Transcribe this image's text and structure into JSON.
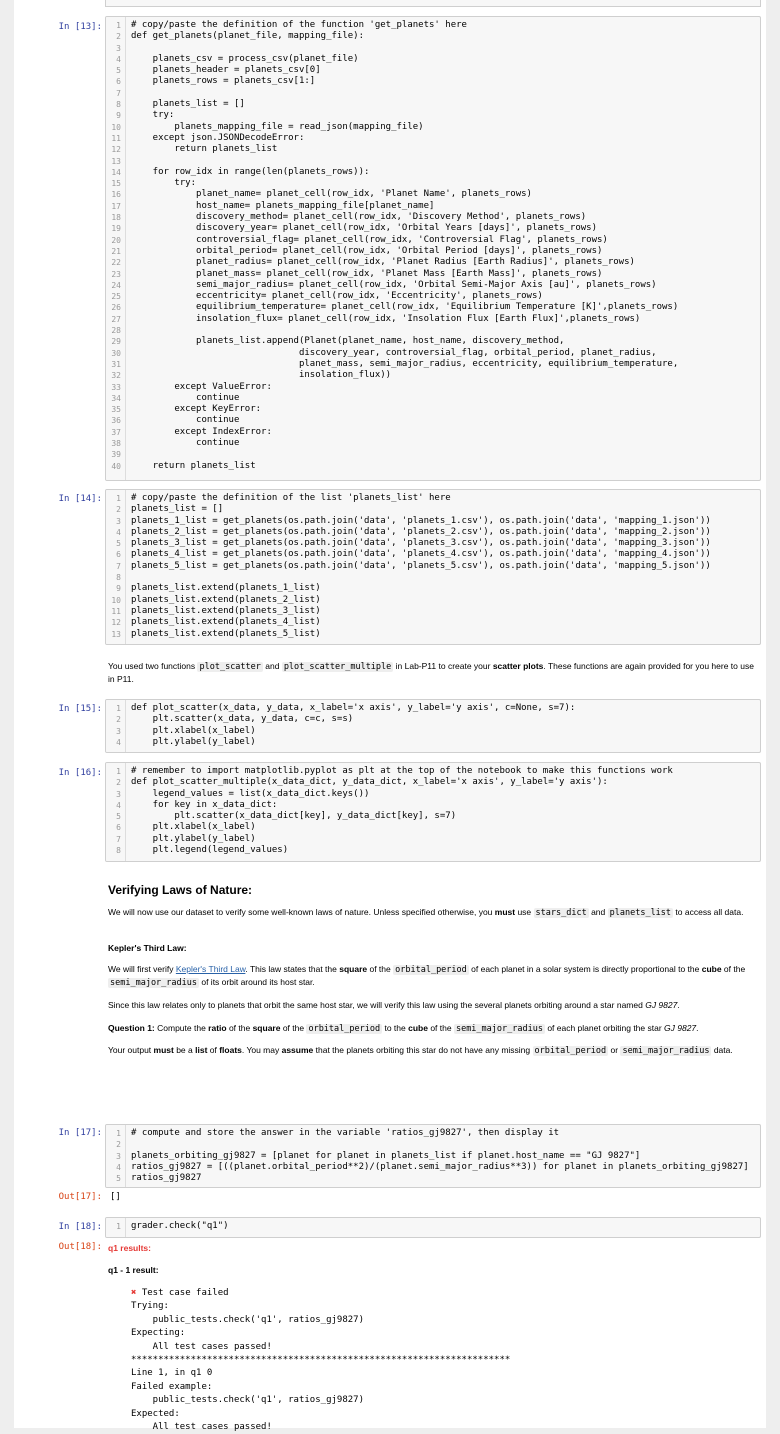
{
  "cells": {
    "c13": {
      "prompt": "In [13]:",
      "lines": [
        "# copy/paste the definition of the function 'get_planets' here",
        "def get_planets(planet_file, mapping_file):",
        "",
        "    planets_csv = process_csv(planet_file)",
        "    planets_header = planets_csv[0]",
        "    planets_rows = planets_csv[1:]",
        "",
        "    planets_list = []",
        "    try:",
        "        planets_mapping_file = read_json(mapping_file)",
        "    except json.JSONDecodeError:",
        "        return planets_list",
        "",
        "    for row_idx in range(len(planets_rows)):",
        "        try:",
        "            planet_name= planet_cell(row_idx, 'Planet Name', planets_rows)",
        "            host_name= planets_mapping_file[planet_name]",
        "            discovery_method= planet_cell(row_idx, 'Discovery Method', planets_rows)",
        "            discovery_year= planet_cell(row_idx, 'Orbital Years [days]', planets_rows)",
        "            controversial_flag= planet_cell(row_idx, 'Controversial Flag', planets_rows)",
        "            orbital_period= planet_cell(row_idx, 'Orbital Period [days]', planets_rows)",
        "            planet_radius= planet_cell(row_idx, 'Planet Radius [Earth Radius]', planets_rows)",
        "            planet_mass= planet_cell(row_idx, 'Planet Mass [Earth Mass]', planets_rows)",
        "            semi_major_radius= planet_cell(row_idx, 'Orbital Semi-Major Axis [au]', planets_rows)",
        "            eccentricity= planet_cell(row_idx, 'Eccentricity', planets_rows)",
        "            equilibrium_temperature= planet_cell(row_idx, 'Equilibrium Temperature [K]',planets_rows)",
        "            insolation_flux= planet_cell(row_idx, 'Insolation Flux [Earth Flux]',planets_rows)",
        "",
        "            planets_list.append(Planet(planet_name, host_name, discovery_method,",
        "                               discovery_year, controversial_flag, orbital_period, planet_radius,",
        "                               planet_mass, semi_major_radius, eccentricity, equilibrium_temperature,",
        "                               insolation_flux))",
        "        except ValueError:",
        "            continue",
        "        except KeyError:",
        "            continue",
        "        except IndexError:",
        "            continue",
        "",
        "    return planets_list"
      ]
    },
    "c14": {
      "prompt": "In [14]:",
      "lines": [
        "# copy/paste the definition of the list 'planets_list' here",
        "planets_list = []",
        "planets_1_list = get_planets(os.path.join('data', 'planets_1.csv'), os.path.join('data', 'mapping_1.json'))",
        "planets_2_list = get_planets(os.path.join('data', 'planets_2.csv'), os.path.join('data', 'mapping_2.json'))",
        "planets_3_list = get_planets(os.path.join('data', 'planets_3.csv'), os.path.join('data', 'mapping_3.json'))",
        "planets_4_list = get_planets(os.path.join('data', 'planets_4.csv'), os.path.join('data', 'mapping_4.json'))",
        "planets_5_list = get_planets(os.path.join('data', 'planets_5.csv'), os.path.join('data', 'mapping_5.json'))",
        "",
        "planets_list.extend(planets_1_list)",
        "planets_list.extend(planets_2_list)",
        "planets_list.extend(planets_3_list)",
        "planets_list.extend(planets_4_list)",
        "planets_list.extend(planets_5_list)"
      ]
    },
    "md1": {
      "t1": "You used two functions ",
      "c1": "plot_scatter",
      "t2": " and ",
      "c2": "plot_scatter_multiple",
      "t3": " in Lab-P11 to create your ",
      "b1": "scatter plots",
      "t4": ". These functions are again provided for you here to use in P11."
    },
    "c15": {
      "prompt": "In [15]:",
      "lines": [
        "def plot_scatter(x_data, y_data, x_label='x axis', y_label='y axis', c=None, s=7):",
        "    plt.scatter(x_data, y_data, c=c, s=s)",
        "    plt.xlabel(x_label)",
        "    plt.ylabel(y_label)"
      ]
    },
    "c16": {
      "prompt": "In [16]:",
      "lines": [
        "# remember to import matplotlib.pyplot as plt at the top of the notebook to make this functions work",
        "def plot_scatter_multiple(x_data_dict, y_data_dict, x_label='x axis', y_label='y axis'):",
        "    legend_values = list(x_data_dict.keys())",
        "    for key in x_data_dict:",
        "        plt.scatter(x_data_dict[key], y_data_dict[key], s=7)",
        "    plt.xlabel(x_label)",
        "    plt.ylabel(y_label)",
        "    plt.legend(legend_values)"
      ]
    },
    "md2": {
      "heading": "Verifying Laws of Nature:",
      "p1a": "We will now use our dataset to verify some well-known laws of nature. Unless specified otherwise, you ",
      "p1b": "must",
      "p1c": " use ",
      "p1d": "stars_dict",
      "p1e": " and ",
      "p1f": "planets_list",
      "p1g": " to access all data.",
      "h3": "Kepler's Third Law:",
      "p2a": "We will first verify ",
      "p2link": "Kepler's Third Law",
      "p2b": ". This law states that the ",
      "p2c": "square",
      "p2d": " of the ",
      "p2e": "orbital_period",
      "p2f": " of each planet in a solar system is directly proportional to the ",
      "p2g": "cube",
      "p2h": " of the ",
      "p2i": "semi_major_radius",
      "p2j": " of its orbit around its host star.",
      "p3a": "Since this law relates only to planets that orbit the same host star, we will verify this law using the several planets orbiting around a star named ",
      "p3b": "GJ 9827",
      "p3c": ".",
      "q1a": "Question 1:",
      "q1b": " Compute the ",
      "q1c": "ratio",
      "q1d": " of the ",
      "q1e": "square",
      "q1f": " of the ",
      "q1g": "orbital_period",
      "q1h": " to the ",
      "q1i": "cube",
      "q1j": " of the ",
      "q1k": "semi_major_radius",
      "q1l": " of each planet orbiting the star ",
      "q1m": "GJ 9827",
      "q1n": ".",
      "p4a": "Your output ",
      "p4b": "must",
      "p4c": " be a ",
      "p4d": "list",
      "p4e": " of ",
      "p4f": "floats",
      "p4g": ". You may ",
      "p4h": "assume",
      "p4i": " that the planets orbiting this star do not have any missing ",
      "p4j": "orbital_period",
      "p4k": " or ",
      "p4l": "semi_major_radius",
      "p4m": " data."
    },
    "c17": {
      "prompt": "In [17]:",
      "out_prompt": "Out[17]:",
      "output": "[]",
      "lines": [
        "# compute and store the answer in the variable 'ratios_gj9827', then display it",
        "",
        "planets_orbiting_gj9827 = [planet for planet in planets_list if planet.host_name == \"GJ 9827\"]",
        "ratios_gj9827 = [((planet.orbital_period**2)/(planet.semi_major_radius**3)) for planet in planets_orbiting_gj9827]",
        "ratios_gj9827"
      ]
    },
    "c18": {
      "prompt": "In [18]:",
      "out_prompt": "Out[18]:",
      "lines": [
        "grader.check(\"q1\")"
      ],
      "results_title": "q1 results:",
      "result_sub": "q1 - 1 result:",
      "output_lines": [
        "Test case failed",
        "Trying:",
        "    public_tests.check('q1', ratios_gj9827)",
        "Expecting:",
        "    All test cases passed!",
        "**********************************************************************",
        "Line 1, in q1 0",
        "Failed example:",
        "    public_tests.check('q1', ratios_gj9827)",
        "Expected:",
        "    All test cases passed!"
      ]
    }
  }
}
